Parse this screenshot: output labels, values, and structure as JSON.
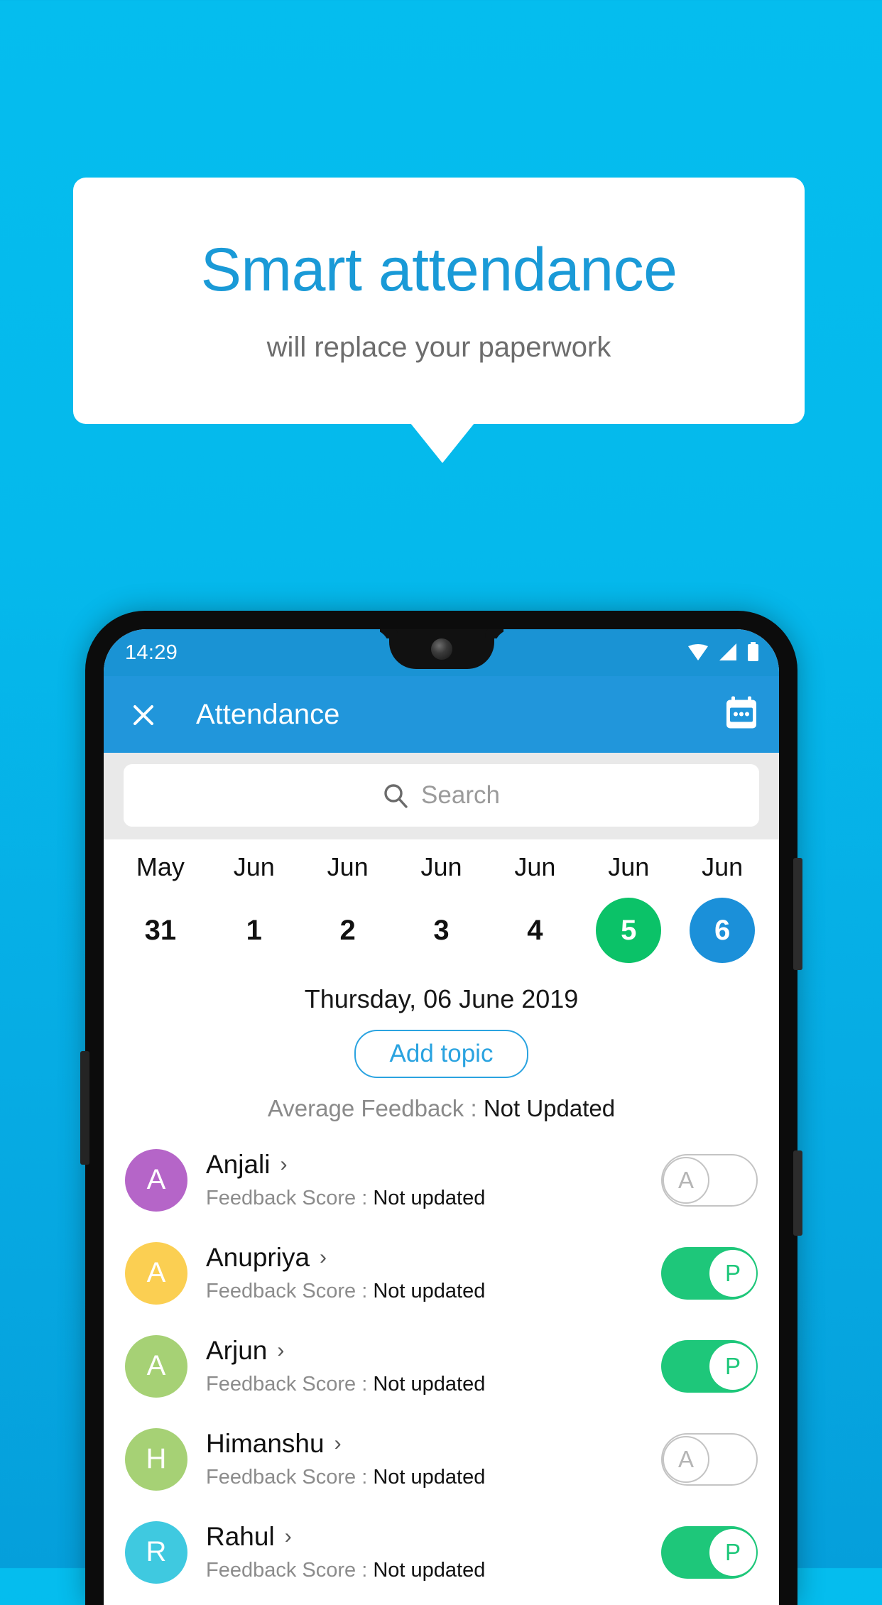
{
  "promo": {
    "title": "Smart attendance",
    "subtitle": "will replace your paperwork"
  },
  "colors": {
    "background_top": "#05bdee",
    "background_bottom": "#059fdb",
    "promo_title": "#1a9ad7",
    "app_bar": "#2196db",
    "status_bar": "#1a93d4",
    "accent_green": "#0bc268",
    "accent_blue": "#1b90d9",
    "toggle_on": "#1ec77a",
    "toggle_off_border": "#c4c4c4"
  },
  "status_bar": {
    "time": "14:29",
    "icons": [
      "wifi-icon",
      "signal-icon",
      "battery-icon"
    ]
  },
  "app_bar": {
    "close_icon": "close-icon",
    "title": "Attendance",
    "calendar_icon": "calendar-icon"
  },
  "search": {
    "icon": "search-icon",
    "placeholder": "Search"
  },
  "date_strip": [
    {
      "month": "May",
      "day": "31",
      "state": "normal"
    },
    {
      "month": "Jun",
      "day": "1",
      "state": "normal"
    },
    {
      "month": "Jun",
      "day": "2",
      "state": "normal"
    },
    {
      "month": "Jun",
      "day": "3",
      "state": "normal"
    },
    {
      "month": "Jun",
      "day": "4",
      "state": "normal"
    },
    {
      "month": "Jun",
      "day": "5",
      "state": "green"
    },
    {
      "month": "Jun",
      "day": "6",
      "state": "blue"
    }
  ],
  "day_header": {
    "date_label": "Thursday, 06 June 2019",
    "add_topic_label": "Add topic",
    "average_feedback_label": "Average Feedback : ",
    "average_feedback_value": "Not Updated"
  },
  "list": {
    "feedback_label": "Feedback Score : ",
    "chevron_icon": "chevron-right-icon",
    "students": [
      {
        "name": "Anjali",
        "initial": "A",
        "avatar_color": "#b565c8",
        "feedback_value": "Not updated",
        "attendance": "A",
        "present": false
      },
      {
        "name": "Anupriya",
        "initial": "A",
        "avatar_color": "#fbcf52",
        "feedback_value": "Not updated",
        "attendance": "P",
        "present": true
      },
      {
        "name": "Arjun",
        "initial": "A",
        "avatar_color": "#a6d175",
        "feedback_value": "Not updated",
        "attendance": "P",
        "present": true
      },
      {
        "name": "Himanshu",
        "initial": "H",
        "avatar_color": "#a6d175",
        "feedback_value": "Not updated",
        "attendance": "A",
        "present": false
      },
      {
        "name": "Rahul",
        "initial": "R",
        "avatar_color": "#3fc9e0",
        "feedback_value": "Not updated",
        "attendance": "P",
        "present": true
      }
    ]
  }
}
